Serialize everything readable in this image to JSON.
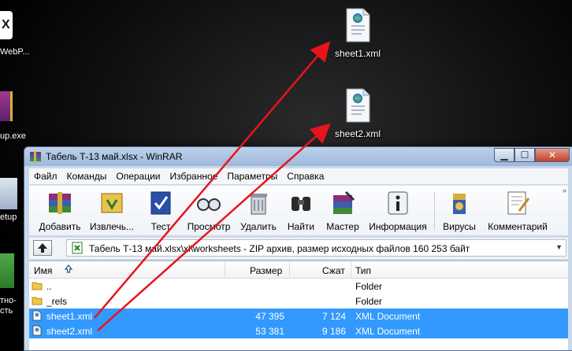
{
  "desktop": {
    "icons": [
      {
        "label": "sheet1.xml",
        "icon": "xml-document-icon"
      },
      {
        "label": "sheet2.xml",
        "icon": "xml-document-icon"
      }
    ],
    "left_partial": [
      "WebP...",
      "up.exe",
      "etup",
      "тно-",
      "сть"
    ]
  },
  "window": {
    "title": "Табель Т-13 май.xlsx - WinRAR",
    "controls": {
      "minimize": "▁",
      "maximize": "☐",
      "close": "✕"
    },
    "menu": [
      "Файл",
      "Команды",
      "Операции",
      "Избранное",
      "Параметры",
      "Справка"
    ],
    "toolbar": [
      {
        "label": "Добавить",
        "icon": "add-archive-icon"
      },
      {
        "label": "Извлечь...",
        "icon": "extract-icon"
      },
      {
        "label": "Тест",
        "icon": "test-icon"
      },
      {
        "label": "Просмотр",
        "icon": "view-icon"
      },
      {
        "label": "Удалить",
        "icon": "delete-icon"
      },
      {
        "label": "Найти",
        "icon": "find-icon"
      },
      {
        "label": "Мастер",
        "icon": "wizard-icon"
      },
      {
        "label": "Информация",
        "icon": "info-icon"
      },
      {
        "label": "Вирусы",
        "icon": "virus-scan-icon"
      },
      {
        "label": "Комментарий",
        "icon": "comment-icon"
      }
    ],
    "address": "Табель Т-13 май.xlsx\\xl\\worksheets - ZIP архив, размер исходных файлов 160 253 байт",
    "columns": {
      "name": "Имя",
      "size": "Размер",
      "packed": "Сжат",
      "type": "Тип"
    },
    "rows": [
      {
        "name": "..",
        "size": "",
        "packed": "",
        "type": "Folder",
        "selected": false
      },
      {
        "name": "_rels",
        "size": "",
        "packed": "",
        "type": "Folder",
        "selected": false
      },
      {
        "name": "sheet1.xml",
        "size": "47 395",
        "packed": "7 124",
        "type": "XML Document",
        "selected": true
      },
      {
        "name": "sheet2.xml",
        "size": "53 381",
        "packed": "9 186",
        "type": "XML Document",
        "selected": true
      }
    ]
  },
  "colors": {
    "selection": "#3399ff",
    "arrow": "#e8141c"
  }
}
